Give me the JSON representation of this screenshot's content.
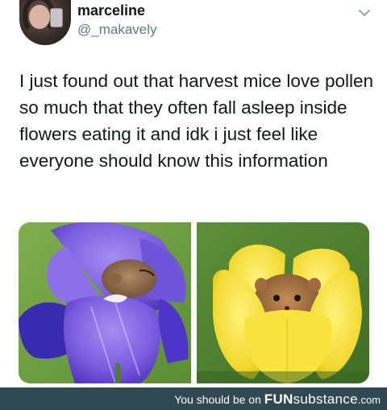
{
  "tweet": {
    "author": {
      "name": "marceline",
      "handle": "@_makavely",
      "avatar": "avatar-photo"
    },
    "menu_icon": "chevron-down-icon",
    "text": "I just found out that harvest mice love pollen so much that they often fall asleep inside flowers eating it and idk i just feel like everyone should know this information",
    "media": [
      {
        "icon": "photo-mouse-in-purple-iris"
      },
      {
        "icon": "photo-mouse-in-yellow-tulip"
      }
    ]
  },
  "footer": {
    "prefix": "You should be on",
    "brand_fun": "FUN",
    "brand_substance": "substance",
    "brand_tld": ".com",
    "background": "#304952"
  }
}
